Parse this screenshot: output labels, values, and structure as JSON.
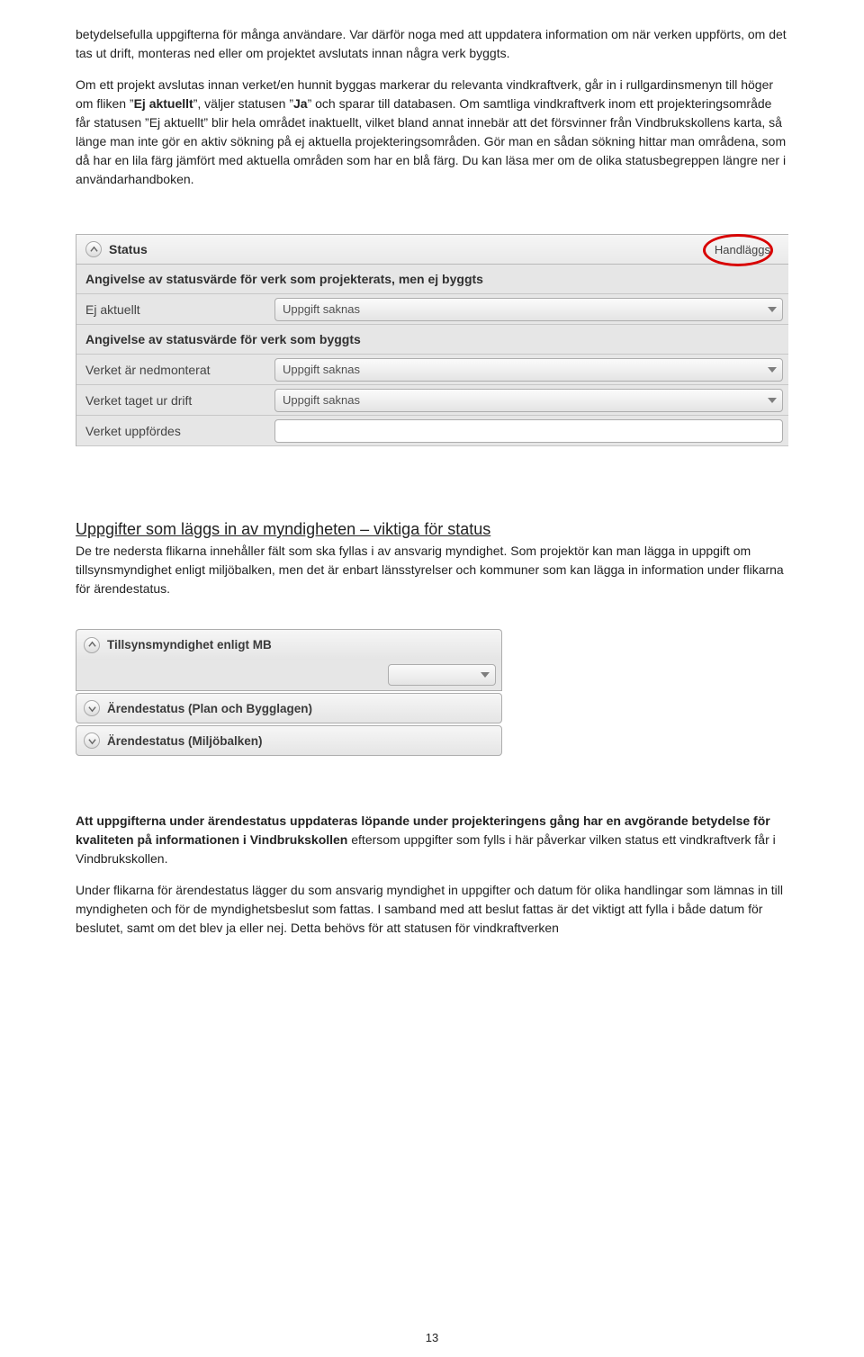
{
  "para1": "betydelsefulla uppgifterna för många användare. Var därför noga med att uppdatera information om när verken uppförts, om det tas ut drift, monteras ned eller om projektet avslutats innan några verk byggts.",
  "para2_a": "Om ett projekt avslutas innan verket/en hunnit byggas markerar du relevanta vindkraftverk, går in i rullgardinsmenyn till höger om fliken ”",
  "para2_ej": "Ej aktuellt",
  "para2_b": "”, väljer statusen ”",
  "para2_ja": "Ja",
  "para2_c": "” och sparar till databasen. Om samtliga vindkraftverk inom ett projekteringsområde får statusen ”Ej aktuellt” blir hela området inaktuellt, vilket bland annat innebär att det försvinner från Vindbrukskollens karta, så länge man inte gör en aktiv sökning på ej aktuella projekteringsområden. Gör man en sådan sökning hittar man områdena, som då har en lila färg jämfört med aktuella områden som har en blå färg. Du kan läsa mer om de olika statusbegreppen längre ner i användarhandboken.",
  "panel": {
    "title": "Status",
    "right": "Handläggs",
    "sect1": "Angivelse av statusvärde för verk som projekterats, men ej byggts",
    "row1_label": "Ej aktuellt",
    "row1_value": "Uppgift saknas",
    "sect2": "Angivelse av statusvärde för verk som byggts",
    "row2a_label": "Verket är nedmonterat",
    "row2a_value": "Uppgift saknas",
    "row2b_label": "Verket taget ur drift",
    "row2b_value": "Uppgift saknas",
    "row2c_label": "Verket uppfördes"
  },
  "h2": "Uppgifter som läggs in av myndigheten – viktiga för status",
  "para3": "De tre nedersta flikarna innehåller fält som ska fyllas i av ansvarig myndighet. Som projektör kan man lägga in uppgift om tillsynsmyndighet enligt miljöbalken, men det är enbart länsstyrelser och kommuner som kan lägga in information under flikarna för ärendestatus.",
  "acc": {
    "item1": "Tillsynsmyndighet enligt MB",
    "item2": "Ärendestatus (Plan och Bygglagen)",
    "item3": "Ärendestatus (Miljöbalken)"
  },
  "para4_a": "Att uppgifterna under ärendestatus uppdateras löpande under projekteringens gång har en avgörande betydelse för kvaliteten på informationen i Vindbrukskollen ",
  "para4_b": "eftersom uppgifter som fylls i här påverkar vilken status ett vindkraftverk får i Vindbrukskollen.",
  "para5": "Under flikarna för ärendestatus lägger du som ansvarig myndighet in uppgifter och datum för olika handlingar som lämnas in till myndigheten och för de myndighetsbeslut som fattas. I samband med att beslut fattas är det viktigt att fylla i både datum för beslutet, samt om det blev ja eller nej. Detta behövs för att statusen för vindkraftverken",
  "page_num": "13"
}
